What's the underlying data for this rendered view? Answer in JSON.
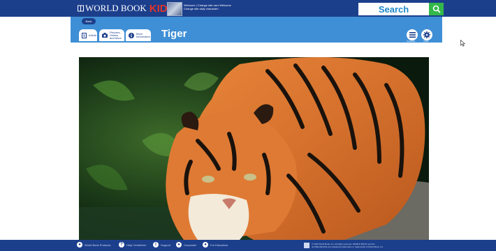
{
  "header": {
    "logo_main": "WORLD BOOK",
    "logo_kids": "KIDS",
    "welcome_line1": "Welcome | Change site user Welcome",
    "welcome_line2": "Change site daily character!",
    "search_label": "Search"
  },
  "subheader": {
    "back_label": "Back",
    "tabs": [
      {
        "label": "Article",
        "icon": "document-icon"
      },
      {
        "label": "Pictures, Videos and More",
        "icon": "camera-icon"
      },
      {
        "label": "More Information",
        "icon": "info-icon"
      }
    ],
    "page_title": "Tiger",
    "tools": [
      {
        "label": "Contents",
        "icon": "list-icon"
      },
      {
        "label": "Tools",
        "icon": "gear-icon"
      }
    ]
  },
  "footer": {
    "links": [
      {
        "label": "World Book Products"
      },
      {
        "label": "Help Centertext"
      },
      {
        "label": "Support"
      },
      {
        "label": "Corporate"
      },
      {
        "label": "For Educators"
      }
    ],
    "copyright_line1": "© 2023 World Book, Inc. All rights reserved. WORLD BOOK and the",
    "copyright_line2": "GLOBE DEVICE are registered trademarks or trademarks of World Book, Inc."
  },
  "colors": {
    "brand_navy": "#1c3f8c",
    "header_blue": "#3f8fd6",
    "kids_red": "#e1342a",
    "search_green": "#33b84a",
    "search_text": "#1e88c8"
  }
}
